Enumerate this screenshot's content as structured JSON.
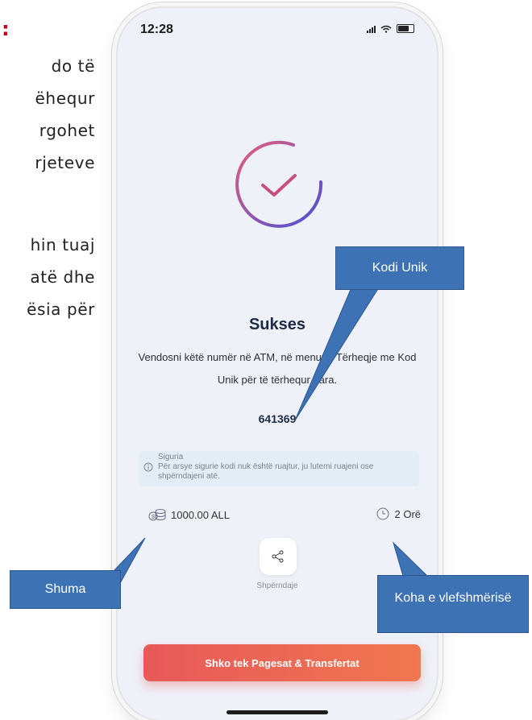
{
  "document": {
    "heading_colon": ":",
    "lines": [
      "do të",
      "ëhequr",
      "rgohet",
      "rjeteve",
      "hin tuaj",
      "atë dhe",
      "ësia për"
    ]
  },
  "phone": {
    "status_bar": {
      "time": "12:28"
    },
    "title": "Sukses",
    "description": "Vendosni këtë numër në ATM, në menunë Tërheqje me Kod Unik për të tërhequr para.",
    "code": "641369",
    "security": {
      "title": "Siguria",
      "text": "Për arsye sigurie kodi nuk është ruajtur, ju lutemi ruajeni ose shpërndajeni atë."
    },
    "amount": "1000.00 ALL",
    "validity": "2 Orë",
    "share_label": "Shpërndaje",
    "cta_label": "Shko tek Pagesat & Transfertat"
  },
  "callouts": {
    "kodi_unik": "Kodi Unik",
    "shuma": "Shuma",
    "koha": "Koha e vlefshmërisë"
  },
  "colors": {
    "callout": "#3d72b4",
    "cta_start": "#e8595a",
    "cta_end": "#f0774f",
    "ring_start": "#e35f7d",
    "ring_end": "#4a4fd8"
  },
  "icons": [
    "signal-icon",
    "wifi-icon",
    "battery-icon",
    "check-circle-icon",
    "info-icon",
    "coins-icon",
    "clock-icon",
    "share-icon"
  ]
}
